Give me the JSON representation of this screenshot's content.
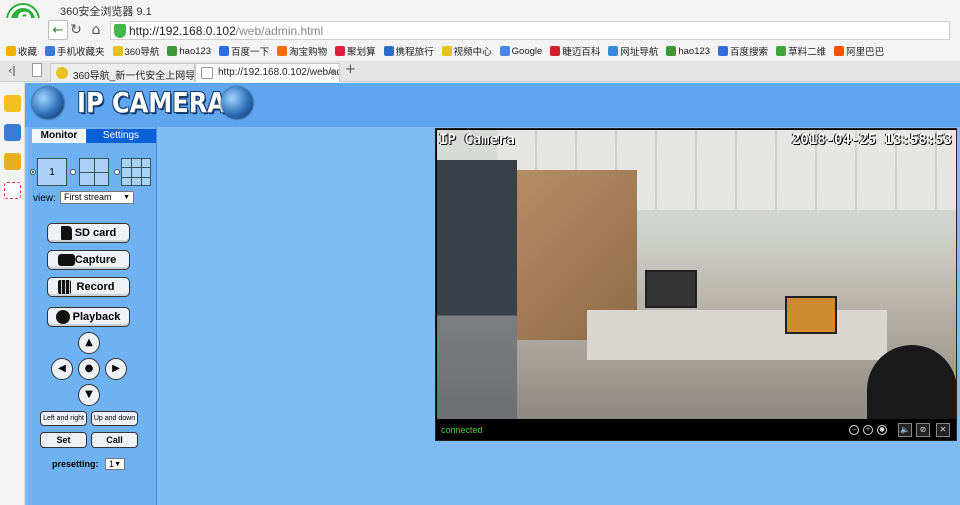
{
  "browser": {
    "title": "360安全浏览器 9.1",
    "url_main": "http://192.168.0.102",
    "url_path": "/web/admin.html",
    "nav": {
      "back": "←",
      "reload": "↻",
      "home": "⌂",
      "fav": "☆"
    }
  },
  "bookmarks": [
    {
      "label": "收藏",
      "icon": "star-icon"
    },
    {
      "label": "手机收藏夹",
      "icon": "phone-icon"
    },
    {
      "label": "360导航",
      "icon": "360-icon"
    },
    {
      "label": "hao123",
      "icon": "hao123-icon"
    },
    {
      "label": "百度一下",
      "icon": "baidu-icon"
    },
    {
      "label": "淘宝购物",
      "icon": "taobao-icon"
    },
    {
      "label": "聚划算",
      "icon": "juhuasuan-icon"
    },
    {
      "label": "携程旅行",
      "icon": "ctrip-icon"
    },
    {
      "label": "视频中心",
      "icon": "video-icon"
    },
    {
      "label": "Google",
      "icon": "google-icon"
    },
    {
      "label": "睫迈百科",
      "icon": "wiki-icon"
    },
    {
      "label": "网址导航",
      "icon": "globe-icon"
    },
    {
      "label": "hao123",
      "icon": "hao123-icon"
    },
    {
      "label": "百度搜索",
      "icon": "baidu-icon"
    },
    {
      "label": "草料二维",
      "icon": "qr-icon"
    },
    {
      "label": "阿里巴巴",
      "icon": "alibaba-icon"
    }
  ],
  "tabs": [
    {
      "label": "360导航_新一代安全上网导航"
    },
    {
      "label": "http://192.168.0.102/web/adm"
    }
  ],
  "tab_ctl": {
    "prev": "‹ǀ",
    "new": "+",
    "close": "×"
  },
  "page": {
    "brand": "IP CAMERA",
    "tab_monitor": "Monitor",
    "tab_settings": "Settings",
    "split_one": "1",
    "view_label": "view:",
    "view_select": "First stream",
    "buttons": {
      "sdcard": "SD card",
      "capture": "Capture",
      "record": "Record",
      "playback": "Playback",
      "left_right": "Left and right",
      "up_down": "Up and down",
      "set": "Set",
      "call": "Call"
    },
    "dpad": {
      "up": "▲",
      "down": "▼",
      "left": "◀",
      "right": "▶",
      "center": "●"
    },
    "preset_label": "presetting:",
    "preset_value": "1"
  },
  "video": {
    "osd_title": "IP Camera",
    "osd_time": "2018-04-25 13:58:53",
    "status": "connected"
  },
  "colors": {
    "page_bg": "#7fbcf5",
    "header_band": "#5fa6ee",
    "tab_active_bar": "#0a60d6",
    "status_green": "#3ed23e"
  }
}
